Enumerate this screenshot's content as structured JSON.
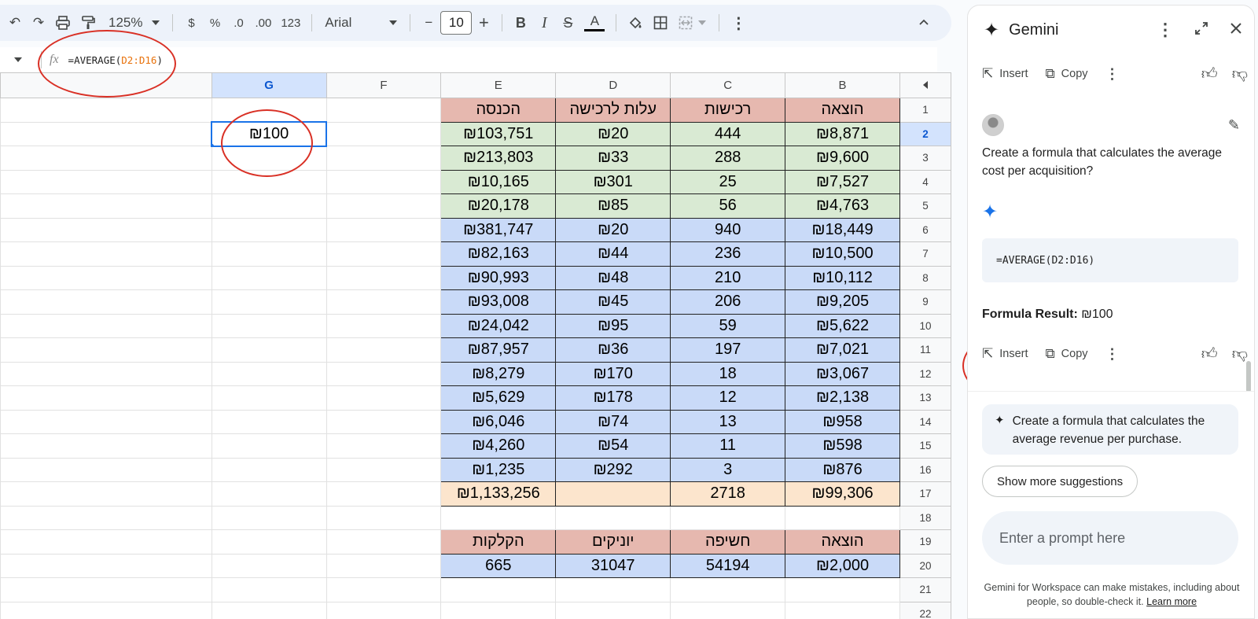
{
  "toolbar": {
    "zoom": "125%",
    "currency": "$",
    "percent": "%",
    "dec_decrease": ".0",
    "dec_increase": ".00",
    "number_format": "123",
    "font": "Arial",
    "font_size": "10",
    "minus": "−",
    "plus": "+",
    "bold": "B",
    "italic": "I",
    "strike": "S",
    "text_color": "A"
  },
  "formula_bar": {
    "fx": "fx",
    "prefix": "=AVERAGE(",
    "ref": "D2:D16",
    "suffix": ")"
  },
  "columns": [
    "G",
    "F",
    "E",
    "D",
    "C",
    "B"
  ],
  "rows": [
    "1",
    "2",
    "3",
    "4",
    "5",
    "6",
    "7",
    "8",
    "9",
    "10",
    "11",
    "12",
    "13",
    "14",
    "15",
    "16",
    "17",
    "18",
    "19",
    "20",
    "21",
    "22"
  ],
  "cells": {
    "g2": "₪100",
    "headers": [
      "הכנסה",
      "עלות לרכישה",
      "רכישות",
      "הוצאה"
    ],
    "data": [
      [
        "₪103,751",
        "₪20",
        "444",
        "₪8,871"
      ],
      [
        "₪213,803",
        "₪33",
        "288",
        "₪9,600"
      ],
      [
        "₪10,165",
        "₪301",
        "25",
        "₪7,527"
      ],
      [
        "₪20,178",
        "₪85",
        "56",
        "₪4,763"
      ],
      [
        "₪381,747",
        "₪20",
        "940",
        "₪18,449"
      ],
      [
        "₪82,163",
        "₪44",
        "236",
        "₪10,500"
      ],
      [
        "₪90,993",
        "₪48",
        "210",
        "₪10,112"
      ],
      [
        "₪93,008",
        "₪45",
        "206",
        "₪9,205"
      ],
      [
        "₪24,042",
        "₪95",
        "59",
        "₪5,622"
      ],
      [
        "₪87,957",
        "₪36",
        "197",
        "₪7,021"
      ],
      [
        "₪8,279",
        "₪170",
        "18",
        "₪3,067"
      ],
      [
        "₪5,629",
        "₪178",
        "12",
        "₪2,138"
      ],
      [
        "₪6,046",
        "₪74",
        "13",
        "₪958"
      ],
      [
        "₪4,260",
        "₪54",
        "11",
        "₪598"
      ],
      [
        "₪1,235",
        "₪292",
        "3",
        "₪876"
      ]
    ],
    "totals": [
      "₪1,133,256",
      "",
      "2718",
      "₪99,306"
    ],
    "headers2": [
      "הקלקות",
      "יוניקים",
      "חשיפה",
      "הוצאה"
    ],
    "data2": [
      "665",
      "31047",
      "54194",
      "₪2,000"
    ]
  },
  "gemini": {
    "title": "Gemini",
    "insert": "Insert",
    "copy": "Copy",
    "prompt": "Create a formula that calculates the average cost per acquisition?",
    "code": "=AVERAGE(D2:D16)",
    "result_label": "Formula Result:",
    "result_value": " ₪100",
    "suggestion": "Create a formula that calculates the average revenue per purchase.",
    "more": "Show more suggestions",
    "placeholder": "Enter a prompt here",
    "disclaimer": "Gemini for Workspace can make mistakes, including about people, so double-check it.",
    "learn_more": "Learn more"
  }
}
